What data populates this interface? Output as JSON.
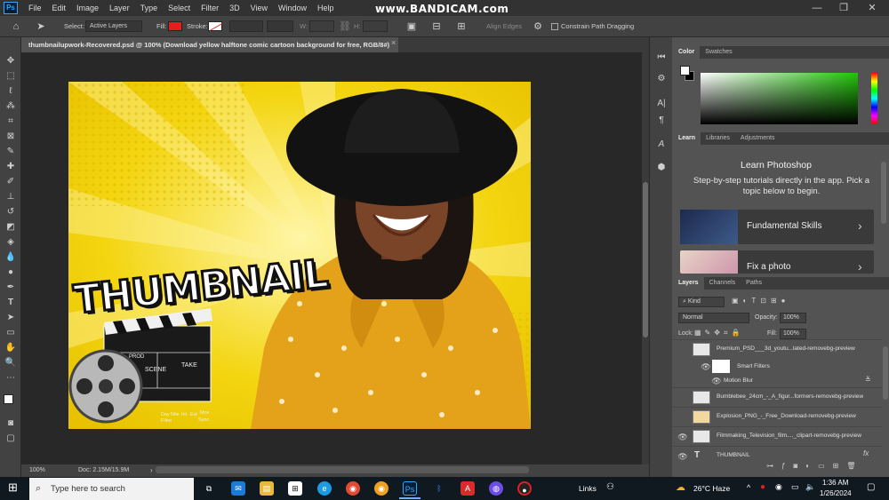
{
  "menubar": {
    "app_icon": "Ps",
    "items": [
      "File",
      "Edit",
      "Image",
      "Layer",
      "Type",
      "Select",
      "Filter",
      "3D",
      "View",
      "Window",
      "Help"
    ],
    "watermark": "www.BANDICAM.com"
  },
  "options": {
    "select_label": "Select:",
    "select_value": "Active Layers",
    "fill_label": "Fill:",
    "fill_color": "#e02020",
    "stroke_label": "Stroke:",
    "w_label": "W:",
    "h_label": "H:",
    "align_edges": "Align Edges",
    "constrain": "Constrain Path Dragging"
  },
  "document": {
    "tab_title": "thumbnailupwork-Recovered.psd @ 100% (Download yellow halftone comic cartoon background for free, RGB/8#)",
    "zoom": "100%",
    "doc_size": "Doc: 2.15M/15.9M"
  },
  "artwork": {
    "headline": "THUMBNAIL",
    "clapper_scene": "SCENE",
    "clapper_take": "TAKE",
    "clapper_prod": "PROD",
    "clapper_day": "Day",
    "clapper_nite": "Nite",
    "clapper_int": "Int",
    "clapper_ext": "Ext",
    "clapper_mos": "Mos",
    "clapper_filter": "Filter",
    "clapper_sync": "Sync",
    "bg_color": "#f3d510",
    "dress_color": "#e3a21a"
  },
  "color_panel": {
    "tabs": [
      "Color",
      "Swatches"
    ]
  },
  "learn_panel": {
    "tabs": [
      "Learn",
      "Libraries",
      "Adjustments"
    ],
    "title": "Learn Photoshop",
    "description": "Step-by-step tutorials directly in the app. Pick a topic below to begin.",
    "cards": [
      "Fundamental Skills",
      "Fix a photo"
    ]
  },
  "layers_panel": {
    "tabs": [
      "Layers",
      "Channels",
      "Paths"
    ],
    "kind": "Kind",
    "blend_mode": "Normal",
    "opacity_label": "Opacity:",
    "opacity": "100%",
    "lock_label": "Lock:",
    "fill_label": "Fill:",
    "fill": "100%",
    "layers": [
      "Premium_PSD___3d_youtu...lated-removebg-preview",
      "Smart Filters",
      "Motion Blur",
      "Bumblebee_24cm_-_A_figur...formers-removebg-preview",
      "Explosion_PNG_-_Free_Download-removebg-preview",
      "Filmmaking_Television_film...._clipart-removebg-preview",
      "THUMBNAIL"
    ]
  },
  "taskbar": {
    "search_placeholder": "Type here to search",
    "links": "Links",
    "weather": "26°C Haze",
    "time": "1:36 AM",
    "date": "1/26/2024"
  }
}
